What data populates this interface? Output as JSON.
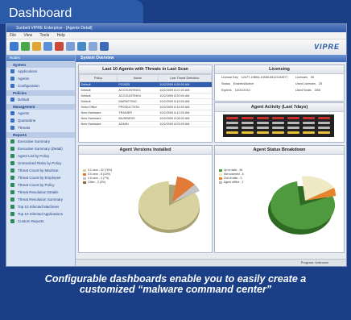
{
  "tab": {
    "title": "Dashboard"
  },
  "window": {
    "title": "Sunbelt VIPRE Enterprise - [Agents Detail]"
  },
  "menu": [
    "File",
    "View",
    "Tools",
    "Help"
  ],
  "brand": {
    "logo": "VIPRE"
  },
  "sidebar": {
    "header": "Nodes",
    "sections": [
      {
        "title": "System",
        "items": [
          "Applications",
          "Agents",
          "Configuration"
        ]
      },
      {
        "title": "Policies",
        "items": [
          "Default"
        ]
      },
      {
        "title": "Management",
        "items": [
          "Agents",
          "Quarantine",
          "Threats"
        ]
      },
      {
        "title": "Reports",
        "items": [
          "Executive Summary",
          "Executive Summary (Detail)",
          "Agent List by Policy",
          "Unresolved Risks by Policy",
          "Threat Count by Machine",
          "Threat Count by Employee",
          "Threat Count by Policy",
          "Threat Resolution Details",
          "Threat Resolution Summary",
          "Top 10 Infected Machines",
          "Top 10 Infected Applications",
          "Custom Reports"
        ]
      }
    ]
  },
  "main": {
    "header": "System Overview",
    "agents_panel": {
      "title": "Last 10 Agents with Threats in Last Scan",
      "columns": [
        "Policy",
        "Name",
        "Last Threat Detection"
      ],
      "rows": [
        [
          "Default",
          "PC0025",
          "10/2/2009 8:55:00 AM"
        ],
        [
          "Default",
          "ACCOUNTING1",
          "10/2/2009 8:21:00 AM"
        ],
        [
          "Default",
          "ACCOUNTING4",
          "10/2/2009 8:20:00 AM"
        ],
        [
          "Default",
          "MARKETING",
          "10/2/2009 8:19:00 AM"
        ],
        [
          "Head Office",
          "PRODUCTION",
          "10/2/2009 8:14:00 AM"
        ],
        [
          "New Hardware",
          "TRAINER",
          "10/2/2009 8:12:00 AM"
        ],
        [
          "New Hardware",
          "IBUSINESS",
          "10/2/2009 8:06:00 AM"
        ],
        [
          "New Hardware",
          "ADMIN",
          "10/2/2009 8:03:00 AM"
        ]
      ]
    },
    "licensing_panel": {
      "title": "Licensing",
      "rows": [
        {
          "label": "License Key",
          "value": "12477-19854-10458-55123-64977"
        },
        {
          "label": "Status",
          "value": "Enabled/Active"
        },
        {
          "label": "Expires",
          "value": "10/31/2010"
        },
        {
          "label": "Licenses",
          "value": "50"
        },
        {
          "label": "Used Licenses",
          "value": "25"
        },
        {
          "label": "Used Seats",
          "value": "3/50"
        }
      ]
    },
    "activity_panel": {
      "title": "Agent Activity (Last 7days)"
    },
    "versions_panel": {
      "title": "Agent Versions Installed",
      "legend": [
        "3.1.xxxx - 42 (76%)",
        "3.0.xxxx - 8 (14%)",
        "2.5.xxxx - 4 (7%)",
        "Other - 2 (3%)"
      ],
      "colors": [
        "#d8d2a0",
        "#e27b3a",
        "#c4c4c4",
        "#8a6a3a"
      ]
    },
    "status_panel": {
      "title": "Agent Status Breakdown",
      "legend": [
        "Up to date - 46",
        "Not scanned - 6",
        "Out of date - 3",
        "Agent offline - 2"
      ],
      "colors": [
        "#4f9a3e",
        "#efe9c4",
        "#e5842f",
        "#b8b8b8"
      ]
    }
  },
  "statusbar": {
    "text": "Program: Unknown"
  },
  "caption": {
    "line1": "Configurable dashboards enable you to easily create a",
    "line2": "customized “malware command center”"
  }
}
